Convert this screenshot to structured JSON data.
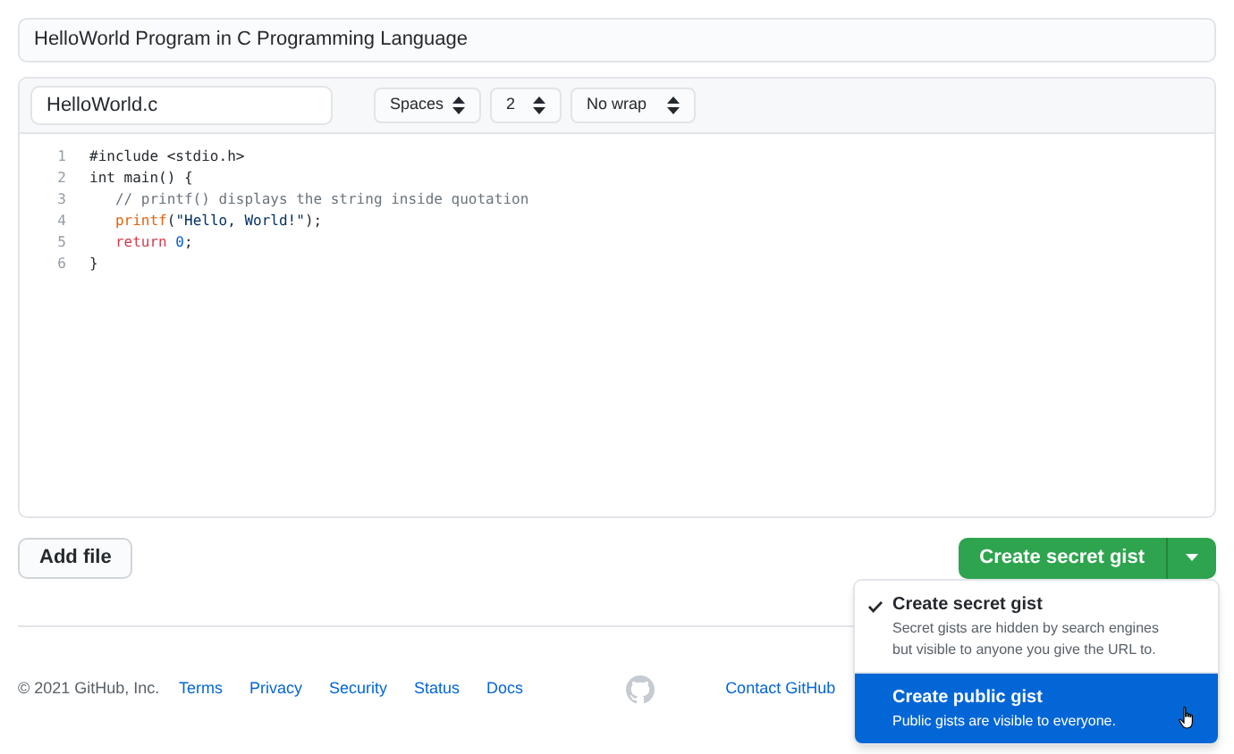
{
  "description": {
    "value": "HelloWorld Program in C Programming Language"
  },
  "editor": {
    "filename": "HelloWorld.c",
    "selects": [
      {
        "value": "Spaces"
      },
      {
        "value": "2"
      },
      {
        "value": "No wrap"
      }
    ],
    "lines": [
      {
        "number": "1",
        "tokens": [
          {
            "kind": "plain",
            "text": "#include <stdio.h>"
          }
        ]
      },
      {
        "number": "2",
        "tokens": [
          {
            "kind": "plain",
            "text": "int main() {"
          }
        ]
      },
      {
        "number": "3",
        "tokens": [
          {
            "kind": "comment",
            "text": "   // printf() displays the string inside quotation"
          }
        ]
      },
      {
        "number": "4",
        "tokens": [
          {
            "kind": "func",
            "text": "   printf"
          },
          {
            "kind": "plain",
            "text": "("
          },
          {
            "kind": "string",
            "text": "\"Hello, World!\""
          },
          {
            "kind": "plain",
            "text": ");"
          }
        ]
      },
      {
        "number": "5",
        "tokens": [
          {
            "kind": "keyword",
            "text": "   return "
          },
          {
            "kind": "number",
            "text": "0"
          },
          {
            "kind": "plain",
            "text": ";"
          }
        ]
      },
      {
        "number": "6",
        "tokens": [
          {
            "kind": "plain",
            "text": "}"
          }
        ]
      }
    ]
  },
  "add_file_button": "Add file",
  "create_button": "Create secret gist",
  "menu": [
    {
      "title": "Create secret gist",
      "text": "Secret gists are hidden by search engines but visible to anyone you give the URL to.",
      "checked": true,
      "highlighted": false
    },
    {
      "title": "Create public gist",
      "text": "Public gists are visible to everyone.",
      "checked": false,
      "highlighted": true
    }
  ],
  "footer": {
    "copyright": "© 2021 GitHub, Inc.",
    "links": [
      "Terms",
      "Privacy",
      "Security",
      "Status",
      "Docs"
    ],
    "right_links": [
      "Contact GitHub"
    ]
  }
}
